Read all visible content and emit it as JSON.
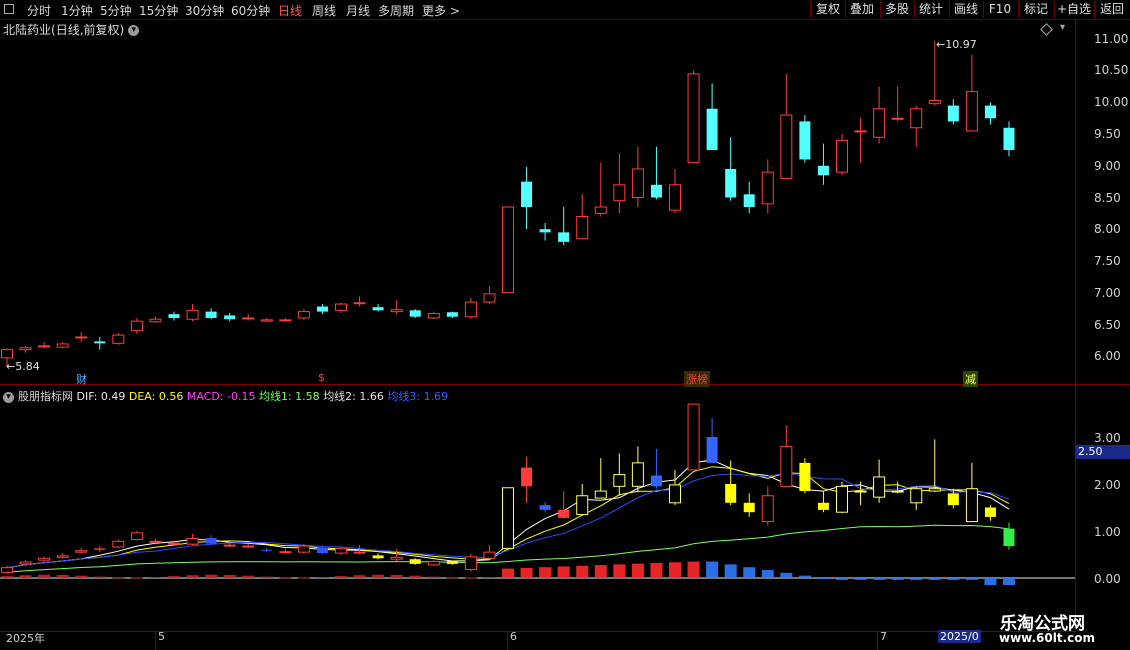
{
  "toolbar": {
    "periods": [
      "分时",
      "1分钟",
      "5分钟",
      "15分钟",
      "30分钟",
      "60分钟",
      "日线",
      "周线",
      "月线",
      "多周期",
      "更多"
    ],
    "active": "日线",
    "right_buttons": [
      "复权",
      "叠加",
      "多股",
      "统计",
      "画线",
      "F10",
      "标记",
      "+自选",
      "返回"
    ]
  },
  "chart": {
    "stock_name": "北陆药业",
    "mode": "(日线,前复权)",
    "high_label": "10.97",
    "low_label": "5.84",
    "y_ticks": [
      "11.00",
      "10.50",
      "10.00",
      "9.50",
      "9.00",
      "8.50",
      "8.00",
      "7.50",
      "7.00",
      "6.50",
      "6.00"
    ],
    "marks": [
      "财",
      "$",
      "涨榜",
      "减"
    ]
  },
  "indicator": {
    "name": "股朋指标网",
    "dif": "DIF: 0.49",
    "dea": "DEA: 0.56",
    "macd": "MACD: -0.15",
    "ma1": "均线1: 1.58",
    "ma2": "均线2: 1.66",
    "ma3": "均线3: 1.69",
    "y_ticks": [
      "3.00",
      "2.00",
      "1.00",
      "0.00"
    ],
    "price_tag": "2.50"
  },
  "time_axis": [
    "2025年",
    "5",
    "6",
    "7",
    "2025/0"
  ],
  "watermark": {
    "line1": "乐淘公式网",
    "line2": "www.60lt.com"
  },
  "colors": {
    "up": "#ff3c3c",
    "down": "#54ffff",
    "grid": "#7a0000",
    "dif": "#ffffff",
    "dea": "#ffff00",
    "macd": "#ff00ff"
  },
  "chart_data": {
    "type": "candlestick",
    "unit": "CNY",
    "candles": [
      {
        "o": 5.97,
        "c": 6.1,
        "h": 6.12,
        "l": 5.84
      },
      {
        "o": 6.1,
        "c": 6.13,
        "h": 6.16,
        "l": 6.05
      },
      {
        "o": 6.16,
        "c": 6.16,
        "h": 6.22,
        "l": 6.12
      },
      {
        "o": 6.14,
        "c": 6.19,
        "h": 6.22,
        "l": 6.12
      },
      {
        "o": 6.3,
        "c": 6.3,
        "h": 6.38,
        "l": 6.22
      },
      {
        "o": 6.23,
        "c": 6.2,
        "h": 6.3,
        "l": 6.1
      },
      {
        "o": 6.2,
        "c": 6.33,
        "h": 6.36,
        "l": 6.18
      },
      {
        "o": 6.4,
        "c": 6.55,
        "h": 6.6,
        "l": 6.35
      },
      {
        "o": 6.54,
        "c": 6.58,
        "h": 6.62,
        "l": 6.52
      },
      {
        "o": 6.66,
        "c": 6.6,
        "h": 6.7,
        "l": 6.56
      },
      {
        "o": 6.58,
        "c": 6.72,
        "h": 6.82,
        "l": 6.55
      },
      {
        "o": 6.7,
        "c": 6.6,
        "h": 6.75,
        "l": 6.58
      },
      {
        "o": 6.64,
        "c": 6.58,
        "h": 6.68,
        "l": 6.55
      },
      {
        "o": 6.6,
        "c": 6.6,
        "h": 6.66,
        "l": 6.56
      },
      {
        "o": 6.55,
        "c": 6.57,
        "h": 6.6,
        "l": 6.54
      },
      {
        "o": 6.56,
        "c": 6.57,
        "h": 6.6,
        "l": 6.54
      },
      {
        "o": 6.6,
        "c": 6.7,
        "h": 6.74,
        "l": 6.57
      },
      {
        "o": 6.78,
        "c": 6.7,
        "h": 6.82,
        "l": 6.66
      },
      {
        "o": 6.72,
        "c": 6.82,
        "h": 6.84,
        "l": 6.68
      },
      {
        "o": 6.84,
        "c": 6.84,
        "h": 6.94,
        "l": 6.78
      },
      {
        "o": 6.77,
        "c": 6.72,
        "h": 6.82,
        "l": 6.7
      },
      {
        "o": 6.7,
        "c": 6.73,
        "h": 6.88,
        "l": 6.66
      },
      {
        "o": 6.72,
        "c": 6.62,
        "h": 6.74,
        "l": 6.6
      },
      {
        "o": 6.6,
        "c": 6.67,
        "h": 6.7,
        "l": 6.58
      },
      {
        "o": 6.69,
        "c": 6.62,
        "h": 6.7,
        "l": 6.6
      },
      {
        "o": 6.62,
        "c": 6.85,
        "h": 6.92,
        "l": 6.58
      },
      {
        "o": 6.85,
        "c": 6.98,
        "h": 7.1,
        "l": 6.82
      },
      {
        "o": 7.0,
        "c": 8.35,
        "h": 8.35,
        "l": 7.0
      },
      {
        "o": 8.75,
        "c": 8.35,
        "h": 8.98,
        "l": 8.0
      },
      {
        "o": 8.0,
        "c": 7.95,
        "h": 8.1,
        "l": 7.82
      },
      {
        "o": 7.95,
        "c": 7.8,
        "h": 8.35,
        "l": 7.75
      },
      {
        "o": 7.85,
        "c": 8.2,
        "h": 8.55,
        "l": 7.85
      },
      {
        "o": 8.25,
        "c": 8.35,
        "h": 9.05,
        "l": 8.2
      },
      {
        "o": 8.45,
        "c": 8.7,
        "h": 9.2,
        "l": 8.25
      },
      {
        "o": 8.5,
        "c": 8.95,
        "h": 9.3,
        "l": 8.35
      },
      {
        "o": 8.7,
        "c": 8.5,
        "h": 9.3,
        "l": 8.47
      },
      {
        "o": 8.3,
        "c": 8.7,
        "h": 8.95,
        "l": 8.25
      },
      {
        "o": 9.05,
        "c": 10.45,
        "h": 10.5,
        "l": 9.05
      },
      {
        "o": 9.9,
        "c": 9.25,
        "h": 10.3,
        "l": 9.25
      },
      {
        "o": 8.95,
        "c": 8.5,
        "h": 9.45,
        "l": 8.45
      },
      {
        "o": 8.55,
        "c": 8.35,
        "h": 8.75,
        "l": 8.25
      },
      {
        "o": 8.4,
        "c": 8.9,
        "h": 9.1,
        "l": 8.25
      },
      {
        "o": 8.8,
        "c": 9.8,
        "h": 10.45,
        "l": 8.8
      },
      {
        "o": 9.7,
        "c": 9.1,
        "h": 9.8,
        "l": 9.05
      },
      {
        "o": 9.0,
        "c": 8.85,
        "h": 9.35,
        "l": 8.7
      },
      {
        "o": 8.9,
        "c": 9.4,
        "h": 9.5,
        "l": 8.85
      },
      {
        "o": 9.55,
        "c": 9.55,
        "h": 9.75,
        "l": 9.05
      },
      {
        "o": 9.45,
        "c": 9.9,
        "h": 10.25,
        "l": 9.35
      },
      {
        "o": 9.75,
        "c": 9.75,
        "h": 10.25,
        "l": 9.7
      },
      {
        "o": 9.6,
        "c": 9.9,
        "h": 9.95,
        "l": 9.3
      },
      {
        "o": 9.98,
        "c": 10.03,
        "h": 10.97,
        "l": 9.95
      },
      {
        "o": 9.95,
        "c": 9.7,
        "h": 10.05,
        "l": 9.65
      },
      {
        "o": 9.55,
        "c": 10.17,
        "h": 10.75,
        "l": 9.55
      },
      {
        "o": 9.95,
        "c": 9.75,
        "h": 10.0,
        "l": 9.65
      },
      {
        "o": 9.6,
        "c": 9.25,
        "h": 9.7,
        "l": 9.15
      }
    ],
    "indicator_candles": [
      {
        "o": 0.12,
        "c": 0.22,
        "h": 0.26,
        "l": 0.08
      },
      {
        "o": 0.3,
        "c": 0.34,
        "h": 0.38,
        "l": 0.26
      },
      {
        "o": 0.38,
        "c": 0.42,
        "h": 0.46,
        "l": 0.34
      },
      {
        "o": 0.44,
        "c": 0.47,
        "h": 0.53,
        "l": 0.41
      },
      {
        "o": 0.55,
        "c": 0.58,
        "h": 0.65,
        "l": 0.52
      },
      {
        "o": 0.63,
        "c": 0.6,
        "h": 0.68,
        "l": 0.55
      },
      {
        "o": 0.66,
        "c": 0.78,
        "h": 0.82,
        "l": 0.64
      },
      {
        "o": 0.82,
        "c": 0.96,
        "h": 1.0,
        "l": 0.8
      },
      {
        "o": 0.78,
        "c": 0.78,
        "h": 0.84,
        "l": 0.74
      },
      {
        "o": 0.74,
        "c": 0.74,
        "h": 0.8,
        "l": 0.7
      },
      {
        "o": 0.72,
        "c": 0.84,
        "h": 0.94,
        "l": 0.7
      },
      {
        "o": 0.85,
        "c": 0.73,
        "h": 0.91,
        "l": 0.71
      },
      {
        "o": 0.7,
        "c": 0.7,
        "h": 0.74,
        "l": 0.66
      },
      {
        "o": 0.68,
        "c": 0.68,
        "h": 0.72,
        "l": 0.64
      },
      {
        "o": 0.6,
        "c": 0.58,
        "h": 0.64,
        "l": 0.55
      },
      {
        "o": 0.56,
        "c": 0.56,
        "h": 0.62,
        "l": 0.52
      },
      {
        "o": 0.55,
        "c": 0.68,
        "h": 0.72,
        "l": 0.52
      },
      {
        "o": 0.65,
        "c": 0.53,
        "h": 0.7,
        "l": 0.5
      },
      {
        "o": 0.53,
        "c": 0.63,
        "h": 0.67,
        "l": 0.49
      },
      {
        "o": 0.55,
        "c": 0.55,
        "h": 0.7,
        "l": 0.5
      },
      {
        "o": 0.48,
        "c": 0.42,
        "h": 0.52,
        "l": 0.4
      },
      {
        "o": 0.4,
        "c": 0.44,
        "h": 0.62,
        "l": 0.36
      },
      {
        "o": 0.4,
        "c": 0.3,
        "h": 0.42,
        "l": 0.28
      },
      {
        "o": 0.28,
        "c": 0.35,
        "h": 0.38,
        "l": 0.26
      },
      {
        "o": 0.36,
        "c": 0.3,
        "h": 0.37,
        "l": 0.28
      },
      {
        "o": 0.18,
        "c": 0.45,
        "h": 0.52,
        "l": 0.14
      },
      {
        "o": 0.42,
        "c": 0.55,
        "h": 0.7,
        "l": 0.4
      },
      {
        "o": 0.63,
        "c": 1.92,
        "h": 1.92,
        "l": 0.63
      },
      {
        "o": 2.35,
        "c": 1.95,
        "h": 2.58,
        "l": 1.6
      },
      {
        "o": 1.55,
        "c": 1.45,
        "h": 1.62,
        "l": 1.4
      },
      {
        "o": 1.45,
        "c": 1.28,
        "h": 1.85,
        "l": 1.26
      },
      {
        "o": 1.35,
        "c": 1.75,
        "h": 2.0,
        "l": 1.35
      },
      {
        "o": 1.7,
        "c": 1.85,
        "h": 2.55,
        "l": 1.7
      },
      {
        "o": 1.95,
        "c": 2.2,
        "h": 2.65,
        "l": 1.75
      },
      {
        "o": 1.95,
        "c": 2.45,
        "h": 2.8,
        "l": 1.82
      },
      {
        "o": 2.18,
        "c": 1.95,
        "h": 2.75,
        "l": 1.9
      },
      {
        "o": 1.6,
        "c": 1.98,
        "h": 2.3,
        "l": 1.55
      },
      {
        "o": 2.3,
        "c": 3.7,
        "h": 3.7,
        "l": 2.3
      },
      {
        "o": 3.0,
        "c": 2.45,
        "h": 3.4,
        "l": 2.45
      },
      {
        "o": 2.0,
        "c": 1.6,
        "h": 2.5,
        "l": 1.55
      },
      {
        "o": 1.6,
        "c": 1.4,
        "h": 1.8,
        "l": 1.3
      },
      {
        "o": 1.2,
        "c": 1.75,
        "h": 1.95,
        "l": 1.12
      },
      {
        "o": 1.95,
        "c": 2.8,
        "h": 3.25,
        "l": 1.95
      },
      {
        "o": 2.45,
        "c": 1.85,
        "h": 2.55,
        "l": 1.8
      },
      {
        "o": 1.6,
        "c": 1.45,
        "h": 1.85,
        "l": 1.4
      },
      {
        "o": 1.4,
        "c": 1.95,
        "h": 2.05,
        "l": 1.38
      },
      {
        "o": 1.85,
        "c": 1.85,
        "h": 2.05,
        "l": 1.55
      },
      {
        "o": 1.72,
        "c": 2.15,
        "h": 2.52,
        "l": 1.6
      },
      {
        "o": 1.85,
        "c": 1.85,
        "h": 2.05,
        "l": 1.8
      },
      {
        "o": 1.6,
        "c": 1.9,
        "h": 1.95,
        "l": 1.45
      },
      {
        "o": 1.85,
        "c": 1.9,
        "h": 2.95,
        "l": 1.83
      },
      {
        "o": 1.8,
        "c": 1.55,
        "h": 1.9,
        "l": 1.48
      },
      {
        "o": 1.2,
        "c": 1.9,
        "h": 2.45,
        "l": 1.2
      },
      {
        "o": 1.5,
        "c": 1.3,
        "h": 1.55,
        "l": 1.22
      },
      {
        "o": 1.05,
        "c": 0.68,
        "h": 1.18,
        "l": 0.6
      }
    ]
  }
}
